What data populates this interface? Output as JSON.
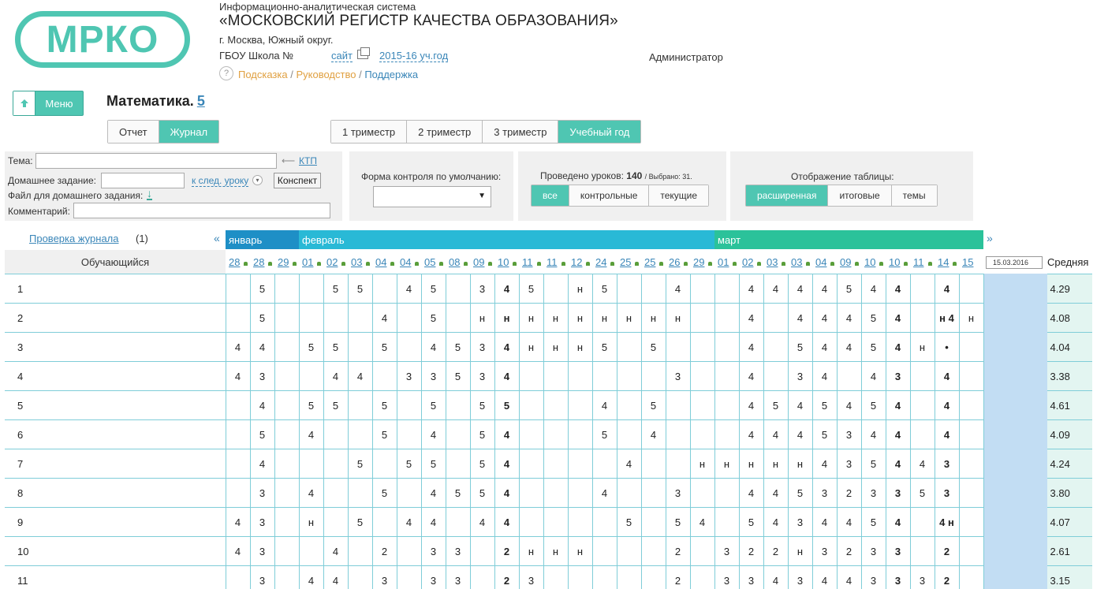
{
  "header": {
    "logo_text": "МРКО",
    "system_subtitle": "Информационно-аналитическая система",
    "system_title": "«МОСКОВСКИЙ РЕГИСТР КАЧЕСТВА ОБРАЗОВАНИЯ»",
    "city": "г. Москва, Южный округ.",
    "school": "ГБОУ Школа №",
    "site_link": "сайт",
    "year_link": "2015-16 уч.год",
    "user_role": "Администратор",
    "help_icon": "?",
    "help_link": "Подсказка",
    "guide_link": "Руководство",
    "support_link": "Поддержка",
    "separator": "/"
  },
  "menu": {
    "label": "Меню",
    "icon": "arrow-up-icon"
  },
  "subject": {
    "name": "Математика.",
    "grade": "5"
  },
  "view_tabs": [
    {
      "label": "Отчет",
      "active": false
    },
    {
      "label": "Журнал",
      "active": true
    }
  ],
  "period_tabs": [
    {
      "label": "1 триместр",
      "active": false
    },
    {
      "label": "2 триместр",
      "active": false
    },
    {
      "label": "3 триместр",
      "active": false
    },
    {
      "label": "Учебный год",
      "active": true
    }
  ],
  "lesson_form": {
    "topic_label": "Тема:",
    "topic_value": "",
    "ktp_link": "КТП",
    "homework_label": "Домашнее задание:",
    "homework_value": "",
    "next_lesson_link": "к след. уроку",
    "summary_button": "Конспект",
    "homework_file_label": "Файл для домашнего задания:",
    "comment_label": "Комментарий:",
    "comment_value": ""
  },
  "control_form": {
    "label": "Форма контроля по умолчанию:",
    "selected": ""
  },
  "lessons": {
    "label": "Проведено уроков:",
    "count": "140",
    "selected_text": "/ Выбрано: 31.",
    "filters": [
      {
        "label": "все",
        "active": true
      },
      {
        "label": "контрольные",
        "active": false
      },
      {
        "label": "текущие",
        "active": false
      }
    ]
  },
  "display": {
    "label": "Отображение таблицы:",
    "options": [
      {
        "label": "расширенная",
        "active": true
      },
      {
        "label": "итоговые",
        "active": false
      },
      {
        "label": "темы",
        "active": false
      }
    ]
  },
  "journal": {
    "check_link": "Проверка журнала",
    "check_count": "(1)",
    "prev_arrow": "«",
    "next_arrow": "»",
    "months": [
      {
        "name": "январь",
        "color": "#1e8fc6"
      },
      {
        "name": "февраль",
        "color": "#29b9d6"
      },
      {
        "name": "март",
        "color": "#2bc29a"
      }
    ],
    "student_header": "Обучающийся",
    "average_header": "Средняя",
    "date_input_value": "15.03.2016",
    "dates": [
      "28",
      "28",
      "29",
      "01",
      "02",
      "03",
      "04",
      "04",
      "05",
      "08",
      "09",
      "10",
      "11",
      "11",
      "12",
      "24",
      "25",
      "25",
      "26",
      "29",
      "01",
      "02",
      "03",
      "03",
      "04",
      "09",
      "10",
      "10",
      "11",
      "14",
      "15"
    ],
    "bold_columns": [
      11,
      27,
      29
    ],
    "rows": [
      {
        "num": "1",
        "avg": "4.29",
        "marks": [
          "",
          "5",
          "",
          "",
          "5",
          "5",
          "",
          "4",
          "5",
          "",
          "3",
          "4",
          "5",
          "",
          "н",
          "5",
          "",
          "",
          "4",
          "",
          "",
          "4",
          "4",
          "4",
          "4",
          "5",
          "4",
          "4",
          "",
          "4",
          ""
        ]
      },
      {
        "num": "2",
        "avg": "4.08",
        "marks": [
          "",
          "5",
          "",
          "",
          "",
          "",
          "4",
          "",
          "5",
          "",
          "н",
          "н",
          "н",
          "н",
          "н",
          "н",
          "н",
          "н",
          "н",
          "",
          "",
          "4",
          "",
          "4",
          "4",
          "4",
          "5",
          "4",
          "",
          "н 4",
          "н"
        ]
      },
      {
        "num": "3",
        "avg": "4.04",
        "marks": [
          "4",
          "4",
          "",
          "5",
          "5",
          "",
          "5",
          "",
          "4",
          "5",
          "3",
          "4",
          "н",
          "н",
          "н",
          "5",
          "",
          "5",
          "",
          "",
          "",
          "4",
          "",
          "5",
          "4",
          "4",
          "5",
          "4",
          "н",
          "•",
          ""
        ]
      },
      {
        "num": "4",
        "avg": "3.38",
        "marks": [
          "4",
          "3",
          "",
          "",
          "4",
          "4",
          "",
          "3",
          "3",
          "5",
          "3",
          "4",
          "",
          "",
          "",
          "",
          "",
          "",
          "3",
          "",
          "",
          "4",
          "",
          "3",
          "4",
          "",
          "4",
          "3",
          "",
          "4",
          ""
        ]
      },
      {
        "num": "5",
        "avg": "4.61",
        "marks": [
          "",
          "4",
          "",
          "5",
          "5",
          "",
          "5",
          "",
          "5",
          "",
          "5",
          "5",
          "",
          "",
          "",
          "4",
          "",
          "5",
          "",
          "",
          "",
          "4",
          "5",
          "4",
          "5",
          "4",
          "5",
          "4",
          "",
          "4",
          ""
        ]
      },
      {
        "num": "6",
        "avg": "4.09",
        "marks": [
          "",
          "5",
          "",
          "4",
          "",
          "",
          "5",
          "",
          "4",
          "",
          "5",
          "4",
          "",
          "",
          "",
          "5",
          "",
          "4",
          "",
          "",
          "",
          "4",
          "4",
          "4",
          "5",
          "3",
          "4",
          "4",
          "",
          "4",
          ""
        ]
      },
      {
        "num": "7",
        "avg": "4.24",
        "marks": [
          "",
          "4",
          "",
          "",
          "",
          "5",
          "",
          "5",
          "5",
          "",
          "5",
          "4",
          "",
          "",
          "",
          "",
          "4",
          "",
          "",
          "н",
          "н",
          "н",
          "н",
          "н",
          "4",
          "3",
          "5",
          "4",
          "4",
          "3",
          ""
        ]
      },
      {
        "num": "8",
        "avg": "3.80",
        "marks": [
          "",
          "3",
          "",
          "4",
          "",
          "",
          "5",
          "",
          "4",
          "5",
          "5",
          "4",
          "",
          "",
          "",
          "4",
          "",
          "",
          "3",
          "",
          "",
          "4",
          "4",
          "5",
          "3",
          "2",
          "3",
          "3",
          "5",
          "3",
          ""
        ]
      },
      {
        "num": "9",
        "avg": "4.07",
        "marks": [
          "4",
          "3",
          "",
          "н",
          "",
          "5",
          "",
          "4",
          "4",
          "",
          "4",
          "4",
          "",
          "",
          "",
          "",
          "5",
          "",
          "5",
          "4",
          "",
          "5",
          "4",
          "3",
          "4",
          "4",
          "5",
          "4",
          "",
          "4 н",
          ""
        ]
      },
      {
        "num": "10",
        "avg": "2.61",
        "marks": [
          "4",
          "3",
          "",
          "",
          "4",
          "",
          "2",
          "",
          "3",
          "3",
          "",
          "2",
          "н",
          "н",
          "н",
          "",
          "",
          "",
          "2",
          "",
          "3",
          "2",
          "2",
          "н",
          "3",
          "2",
          "3",
          "3",
          "",
          "2",
          ""
        ]
      },
      {
        "num": "11",
        "avg": "3.15",
        "marks": [
          "",
          "3",
          "",
          "4",
          "4",
          "",
          "3",
          "",
          "3",
          "3",
          "",
          "2",
          "3",
          "",
          "",
          "",
          "",
          "",
          "2",
          "",
          "3",
          "3",
          "4",
          "3",
          "4",
          "4",
          "3",
          "3",
          "3",
          "2",
          ""
        ]
      }
    ]
  }
}
